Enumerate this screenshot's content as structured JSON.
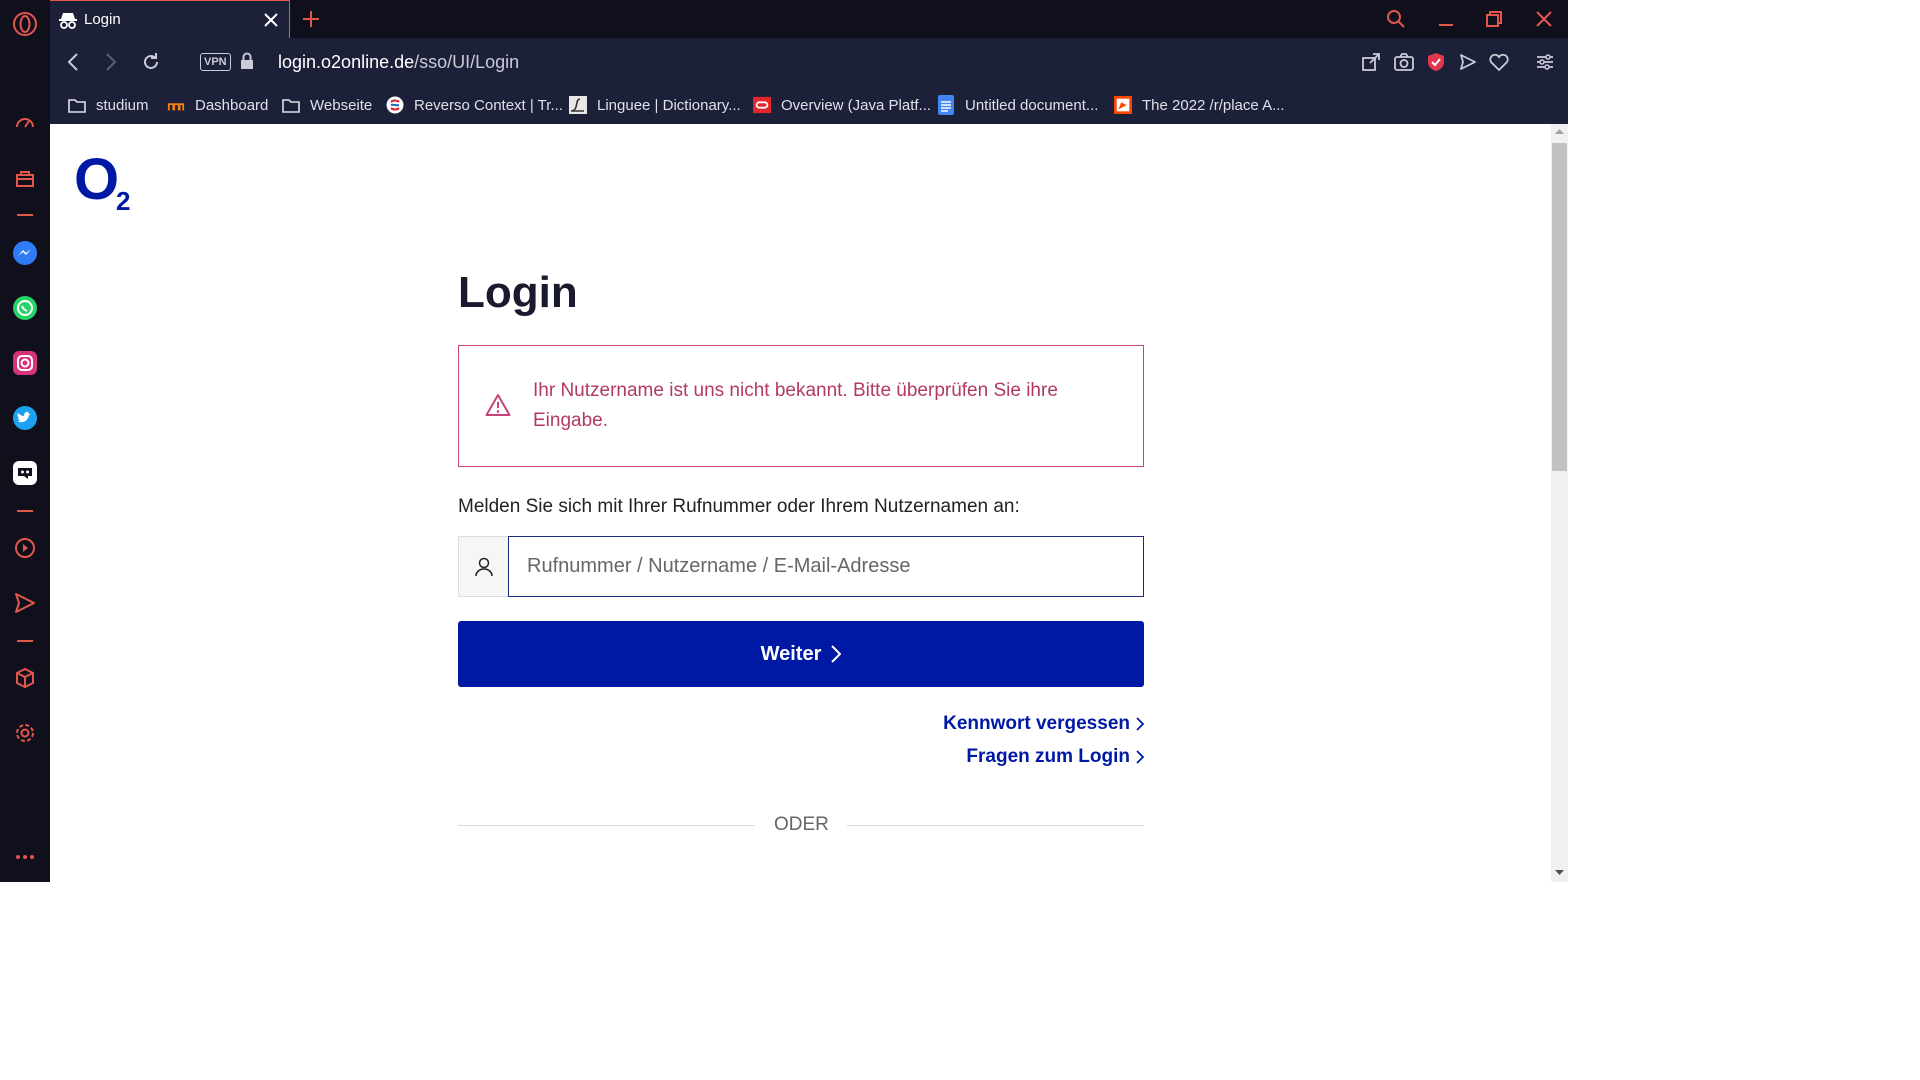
{
  "browser": {
    "tab": {
      "title": "Login"
    },
    "url": {
      "host": "login.o2online.de",
      "path": "/sso/UI/Login"
    },
    "vpn_label": "VPN",
    "bookmarks": [
      {
        "label": "studium",
        "icon": "folder-icon"
      },
      {
        "label": "Dashboard",
        "icon": "moodle-icon"
      },
      {
        "label": "Webseite",
        "icon": "folder-icon"
      },
      {
        "label": "Reverso Context | Tr...",
        "icon": "reverso-icon"
      },
      {
        "label": "Linguee | Dictionary...",
        "icon": "linguee-icon"
      },
      {
        "label": "Overview (Java Platf...",
        "icon": "oracle-icon"
      },
      {
        "label": "Untitled document...",
        "icon": "google-docs-icon"
      },
      {
        "label": "The 2022 /r/place A...",
        "icon": "reddit-place-icon"
      }
    ],
    "accent_color": "#e2564c",
    "chrome_bg": "#1c2038"
  },
  "page": {
    "logo": {
      "letter": "O",
      "subscript": "2"
    },
    "title": "Login",
    "error": "Ihr Nutzername ist uns nicht bekannt. Bitte überprüfen Sie ihre Eingabe.",
    "prompt": "Melden Sie sich mit Ihrer Rufnummer oder Ihrem Nutzernamen an:",
    "input": {
      "placeholder": "Rufnummer / Nutzername / E-Mail-Adresse",
      "value": ""
    },
    "submit_label": "Weiter",
    "forgot_password": "Kennwort vergessen",
    "login_help": "Fragen zum Login",
    "divider": "ODER",
    "brand_color": "#0019a5",
    "error_color": "#b23a5e"
  }
}
